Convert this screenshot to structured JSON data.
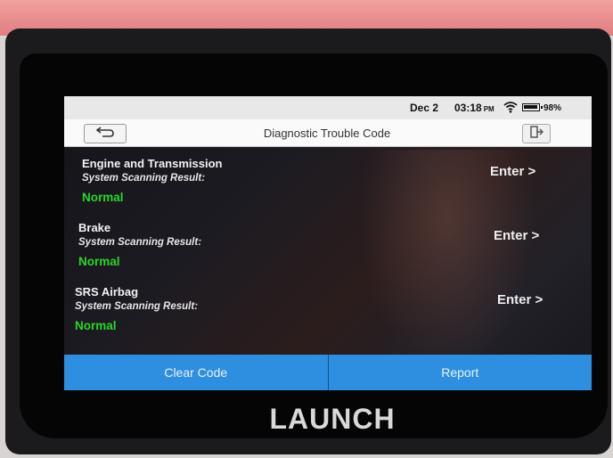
{
  "status": {
    "date": "Dec 2",
    "time": "03:18",
    "ampm": "PM",
    "battery": "98%"
  },
  "header": {
    "title": "Diagnostic Trouble Code"
  },
  "systems": [
    {
      "name": "Engine and Transmission",
      "label": "System Scanning Result:",
      "result": "Normal",
      "action": "Enter >"
    },
    {
      "name": "Brake",
      "label": "System Scanning Result:",
      "result": "Normal",
      "action": "Enter >"
    },
    {
      "name": "SRS Airbag",
      "label": "System Scanning Result:",
      "result": "Normal",
      "action": "Enter >"
    }
  ],
  "footer": {
    "clear_label": "Clear Code",
    "report_label": "Report"
  },
  "device": {
    "brand": "LAUNCH"
  },
  "colors": {
    "accent": "#2e8fe0",
    "normal_status": "#2bd62b"
  },
  "icons": {
    "back": "back-arrow-icon",
    "exit": "exit-icon",
    "wifi": "wifi-icon",
    "battery": "battery-icon"
  }
}
